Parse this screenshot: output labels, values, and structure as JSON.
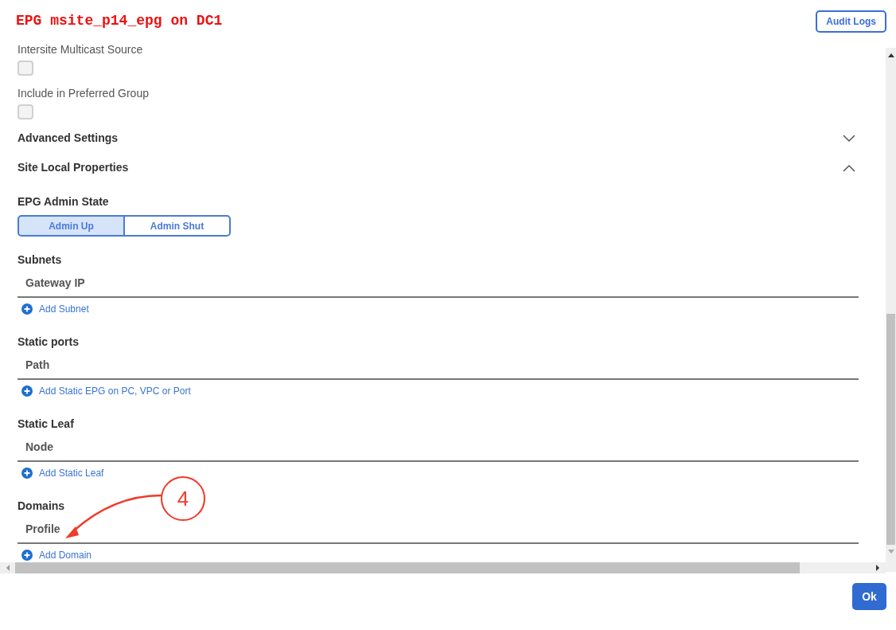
{
  "title": "EPG msite_p14_epg on DC1",
  "audit_button": "Audit Logs",
  "checkboxes": [
    {
      "label": "Intersite Multicast Source",
      "checked": false
    },
    {
      "label": "Include in Preferred Group",
      "checked": false
    }
  ],
  "collapsibles": [
    {
      "label": "Advanced Settings",
      "expanded": false
    },
    {
      "label": "Site Local Properties",
      "expanded": true
    }
  ],
  "admin_state": {
    "label": "EPG Admin State",
    "options": [
      {
        "label": "Admin Up",
        "selected": true
      },
      {
        "label": "Admin Shut",
        "selected": false
      }
    ]
  },
  "tables": [
    {
      "title": "Subnets",
      "column": "Gateway IP",
      "add": "Add Subnet"
    },
    {
      "title": "Static ports",
      "column": "Path",
      "add": "Add Static EPG on PC, VPC or Port"
    },
    {
      "title": "Static Leaf",
      "column": "Node",
      "add": "Add Static Leaf"
    },
    {
      "title": "Domains",
      "column": "Profile",
      "add": "Add Domain"
    }
  ],
  "annotation": {
    "number": "4"
  },
  "ok_button": "Ok"
}
